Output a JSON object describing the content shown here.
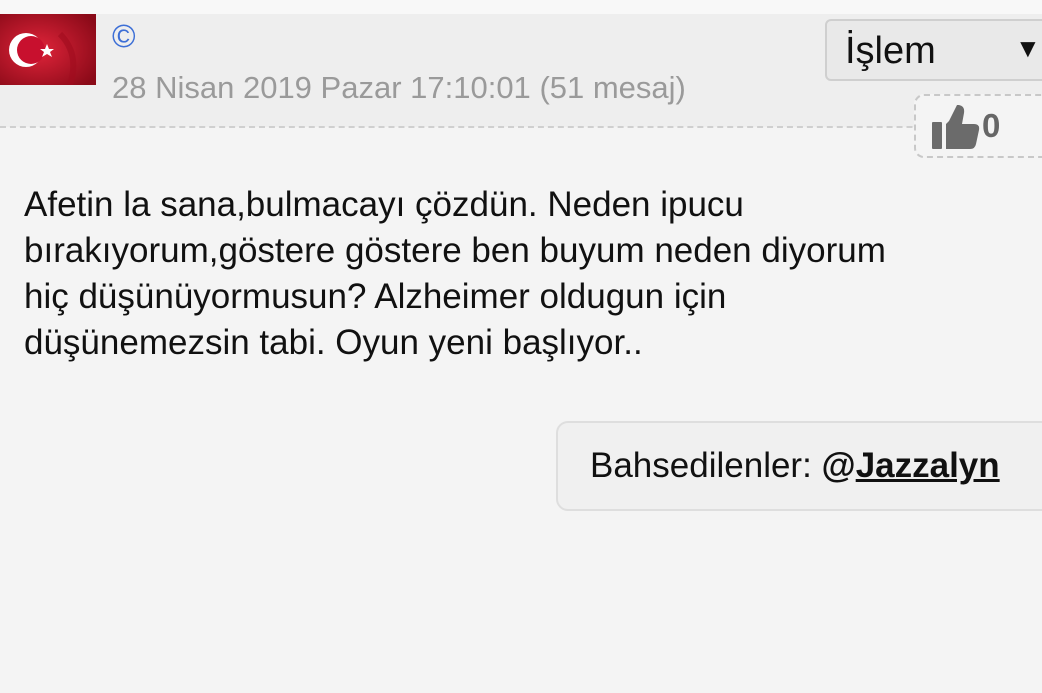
{
  "post": {
    "author_icon": "©",
    "date": "28 Nisan 2019 Pazar 17:10:01",
    "message_count": "(51 mesaj)",
    "action_label": "İşlem",
    "action_arrow": "▼",
    "likes": "0",
    "body_lines": [
      "Afetin la sana,bulmacayı çözdün. Neden ipucu",
      "bırakıyorum,göstere göstere ben buyum neden diyorum",
      "hiç düşünüyormusun? Alzheimer oldugun için",
      "düşünemezsin tabi. Oyun yeni başlıyor.."
    ],
    "mentions_label": "Bahsedilenler:",
    "mention_at": "@",
    "mention_handle": "Jazzalyn"
  },
  "colors": {
    "username": "#3d6fd6",
    "meta": "#9a9a9a",
    "flag_red": "#c8102e"
  },
  "icons": {
    "avatar": "turkish-flag-avatar",
    "like": "thumbs-up-icon",
    "dropdown": "triangle-down-icon"
  }
}
